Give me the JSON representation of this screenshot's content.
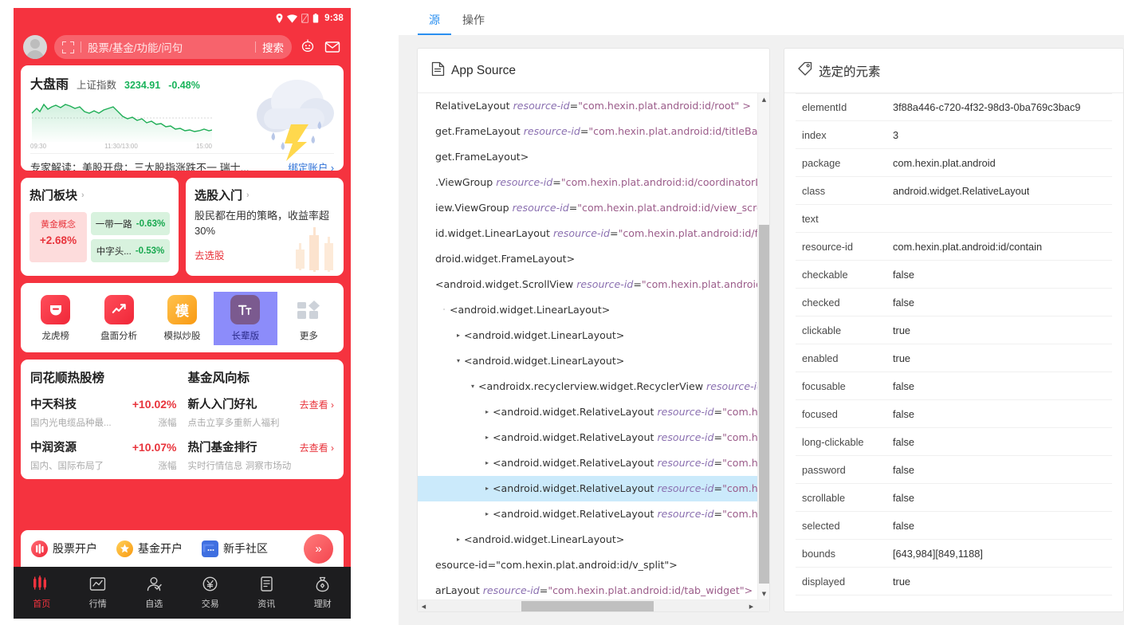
{
  "phone": {
    "status_bar": {
      "time": "9:38",
      "icons": [
        "location-icon",
        "wifi-icon",
        "sim-icon",
        "battery-icon"
      ]
    },
    "top_bar": {
      "avatar": "user-avatar",
      "scan_icon": "scan-icon",
      "search_placeholder": "股票/基金/功能/问句",
      "search_button": "搜索",
      "assistant_icon": "assistant-robot-icon",
      "mail_icon": "mail-icon"
    },
    "market_card": {
      "title": "大盘雨",
      "index_name": "上证指数",
      "index_value": "3234.91",
      "index_change": "-0.48%",
      "axis": [
        "09:30",
        "11:30/13:00",
        "15:00"
      ],
      "news": "专家解读：美股开盘：三大股指涨跌不一 瑞士...",
      "link": "绑定账户 ›",
      "weather_icon": "thunderstorm-cloud-icon",
      "change_color": "#18b35a"
    },
    "hot_plates": {
      "title": "热门板块",
      "main": {
        "name": "黄金概念",
        "pct": "+2.68%"
      },
      "subs": [
        {
          "name": "一带一路",
          "pct": "-0.63%"
        },
        {
          "name": "中字头...",
          "pct": "-0.53%"
        }
      ]
    },
    "stock_picking": {
      "title": "选股入门",
      "desc": "股民都在用的策略，收益率超30%",
      "link": "去选股"
    },
    "icon_row": [
      {
        "label": "龙虎榜",
        "icon": "dragon-tiger-list-icon",
        "color": "#F5333F",
        "selected": false
      },
      {
        "label": "盘面分析",
        "icon": "market-analysis-icon",
        "color": "#F5333F",
        "selected": false
      },
      {
        "label": "模拟炒股",
        "icon": "simulated-trading-icon",
        "color": "#FBA119",
        "selected": false
      },
      {
        "label": "长辈版",
        "icon": "elder-mode-icon",
        "color": "#7b5a8f",
        "selected": true
      },
      {
        "label": "更多",
        "icon": "more-grid-icon",
        "color": "#c9cdd4",
        "selected": false
      }
    ],
    "hot_stocks": {
      "title": "同花顺热股榜",
      "rows": [
        {
          "name": "中天科技",
          "pct": "+10.02%",
          "desc": "国内光电缆品种最...",
          "label": "涨幅"
        },
        {
          "name": "中润资源",
          "pct": "+10.07%",
          "desc": "国内、国际布局了",
          "label": "涨幅"
        }
      ]
    },
    "fund_vane": {
      "title": "基金风向标",
      "rows": [
        {
          "name": "新人入门好礼",
          "go": "去查看 ›",
          "desc": "点击立享多重新人福利"
        },
        {
          "name": "热门基金排行",
          "go": "去查看 ›",
          "desc": "实时行情信息 洞察市场动"
        }
      ]
    },
    "promo": [
      {
        "label": "股票开户",
        "icon": "stock-account-icon",
        "color": "#F5333F"
      },
      {
        "label": "基金开户",
        "icon": "fund-account-icon",
        "color": "#FBA119"
      },
      {
        "label": "新手社区",
        "icon": "community-icon",
        "color": "#3f6fe0"
      }
    ],
    "promo_more": "»",
    "bottom_nav": [
      {
        "label": "首页",
        "icon": "home-candles-icon",
        "active": true
      },
      {
        "label": "行情",
        "icon": "quotes-chart-icon",
        "active": false
      },
      {
        "label": "自选",
        "icon": "watchlist-person-icon",
        "active": false
      },
      {
        "label": "交易",
        "icon": "trade-yuan-icon",
        "active": false
      },
      {
        "label": "资讯",
        "icon": "news-doc-icon",
        "active": false
      },
      {
        "label": "理财",
        "icon": "wealth-bag-icon",
        "active": false
      }
    ],
    "accent_red": "#F5333F",
    "up_color": "#E8343C"
  },
  "inspector": {
    "tabs": [
      {
        "label": "源",
        "active": true
      },
      {
        "label": "操作",
        "active": false
      }
    ],
    "accent": "#2a8ff0",
    "source_panel": {
      "title": "App Source",
      "icon": "document-icon",
      "lines": [
        {
          "indent": 0,
          "arrow": "",
          "text": "RelativeLayout resource-id=\"com.hexin.plat.android:id/root\" >",
          "faded": true,
          "clipped": true
        },
        {
          "indent": 0,
          "arrow": "",
          "text": "get.FrameLayout resource-id=\"com.hexin.plat.android:id/titleBar_contain",
          "clipped": true
        },
        {
          "indent": 0,
          "arrow": "",
          "text": "get.FrameLayout>",
          "clipped": true
        },
        {
          "indent": 0,
          "arrow": "",
          "text": ".ViewGroup resource-id=\"com.hexin.plat.android:id/coordinatorLayout\">",
          "clipped": true
        },
        {
          "indent": 0,
          "arrow": "",
          "text": "iew.ViewGroup resource-id=\"com.hexin.plat.android:id/view_scroller\">",
          "clipped": true
        },
        {
          "indent": 0,
          "arrow": "",
          "text": "id.widget.LinearLayout resource-id=\"com.hexin.plat.android:id/firstPage\"",
          "clipped": true
        },
        {
          "indent": 0,
          "arrow": "",
          "text": "droid.widget.FrameLayout>",
          "clipped": true
        },
        {
          "indent": 0,
          "arrow": "",
          "text": "<android.widget.ScrollView resource-id=\"com.hexin.plat.android:id/scrol",
          "clipped": true
        },
        {
          "indent": 1,
          "arrow": "dot",
          "text": "<android.widget.LinearLayout>"
        },
        {
          "indent": 2,
          "arrow": "right",
          "text": "<android.widget.LinearLayout>"
        },
        {
          "indent": 2,
          "arrow": "down",
          "text": "<android.widget.LinearLayout>"
        },
        {
          "indent": 3,
          "arrow": "down",
          "text": "<androidx.recyclerview.widget.RecyclerView resource-id=\"com",
          "clipped": true
        },
        {
          "indent": 4,
          "arrow": "right",
          "text": "<android.widget.RelativeLayout resource-id=\"com.hexin.pl",
          "clipped": true
        },
        {
          "indent": 4,
          "arrow": "right",
          "text": "<android.widget.RelativeLayout resource-id=\"com.hexin.pl",
          "clipped": true
        },
        {
          "indent": 4,
          "arrow": "right",
          "text": "<android.widget.RelativeLayout resource-id=\"com.hexin.pl",
          "clipped": true
        },
        {
          "indent": 4,
          "arrow": "right",
          "text": "<android.widget.RelativeLayout resource-id=\"com.hexin.pl",
          "clipped": true,
          "selected": true
        },
        {
          "indent": 4,
          "arrow": "right",
          "text": "<android.widget.RelativeLayout resource-id=\"com.hexin.pl",
          "clipped": true
        },
        {
          "indent": 2,
          "arrow": "right",
          "text": "<android.widget.LinearLayout>"
        },
        {
          "indent": 0,
          "arrow": "",
          "text": "esource-id=\"com.hexin.plat.android:id/v_split\">",
          "clipped": true
        },
        {
          "indent": 0,
          "arrow": "",
          "text": "arLayout resource-id=\"com.hexin.plat.android:id/tab_widget\">",
          "clipped": true
        }
      ]
    },
    "selected_panel": {
      "title": "选定的元素",
      "icon": "tag-icon",
      "rows": [
        {
          "key": "elementId",
          "value": "3f88a446-c720-4f32-98d3-0ba769c3bac9"
        },
        {
          "key": "index",
          "value": "3"
        },
        {
          "key": "package",
          "value": "com.hexin.plat.android"
        },
        {
          "key": "class",
          "value": "android.widget.RelativeLayout"
        },
        {
          "key": "text",
          "value": ""
        },
        {
          "key": "resource-id",
          "value": "com.hexin.plat.android:id/contain"
        },
        {
          "key": "checkable",
          "value": "false"
        },
        {
          "key": "checked",
          "value": "false"
        },
        {
          "key": "clickable",
          "value": "true"
        },
        {
          "key": "enabled",
          "value": "true"
        },
        {
          "key": "focusable",
          "value": "false"
        },
        {
          "key": "focused",
          "value": "false"
        },
        {
          "key": "long-clickable",
          "value": "false"
        },
        {
          "key": "password",
          "value": "false"
        },
        {
          "key": "scrollable",
          "value": "false"
        },
        {
          "key": "selected",
          "value": "false"
        },
        {
          "key": "bounds",
          "value": "[643,984][849,1188]"
        },
        {
          "key": "displayed",
          "value": "true"
        }
      ]
    }
  }
}
